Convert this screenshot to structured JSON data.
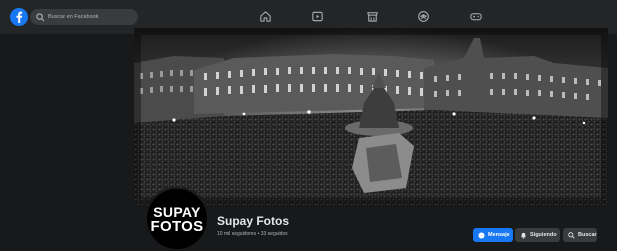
{
  "search": {
    "placeholder": "Buscar en Facebook"
  },
  "nav": {
    "icons": [
      "home-icon",
      "watch-icon",
      "marketplace-icon",
      "groups-icon",
      "gaming-icon"
    ]
  },
  "page": {
    "name": "Supay Fotos",
    "stats": "10 mil seguidores • 33 seguidos",
    "avatar_lines": [
      "SUPAY",
      "FOTOS"
    ]
  },
  "actions": {
    "message": "Mensaje",
    "following": "Siguiendo",
    "search": "Buscar"
  },
  "colors": {
    "brand": "#1877f2",
    "background": "#18191a",
    "topbar": "#242526",
    "button_secondary": "#3a3b3c"
  }
}
